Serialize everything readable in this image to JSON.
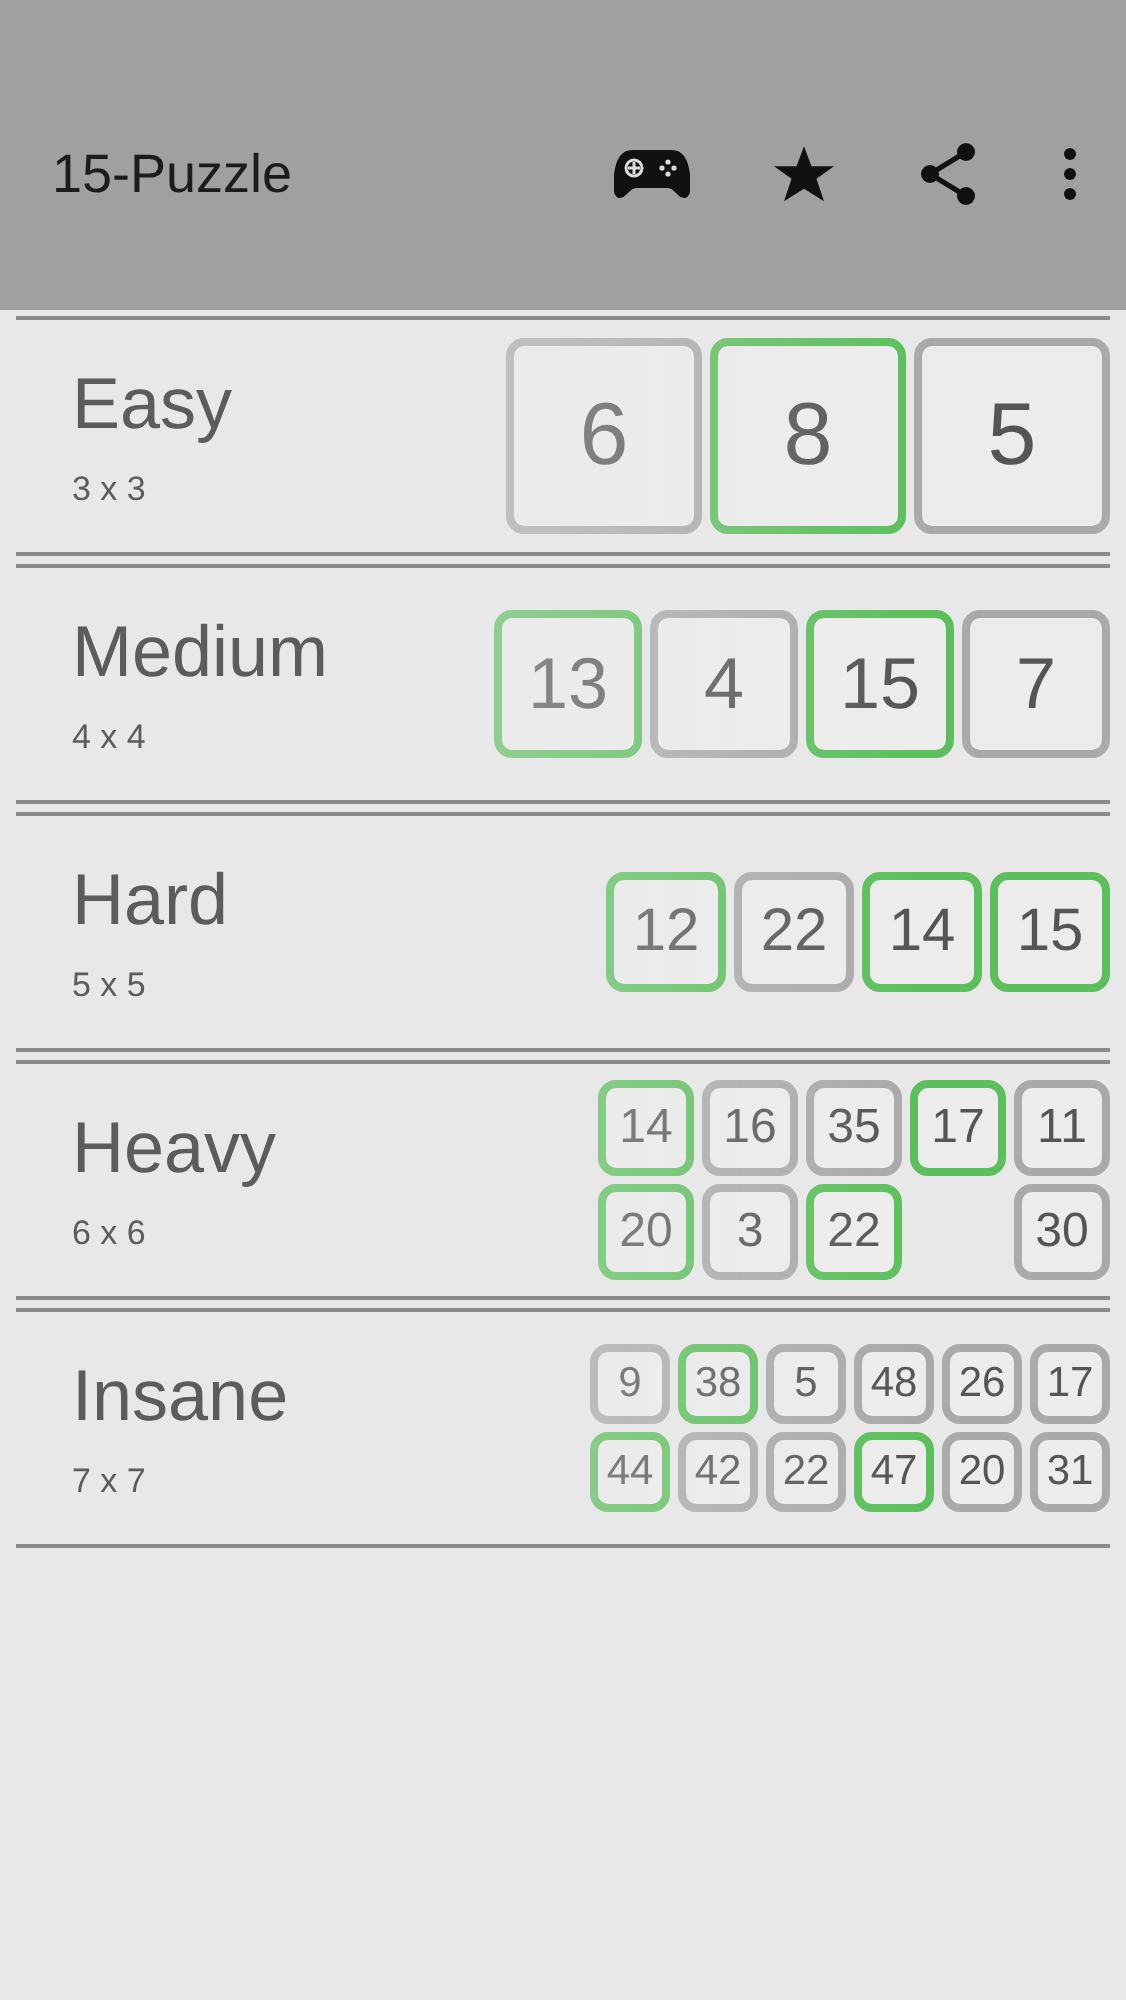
{
  "app_bar": {
    "title": "15-Puzzle"
  },
  "levels": [
    {
      "name": "Easy",
      "size": "3 x 3",
      "tile_rows": [
        [
          {
            "n": "6",
            "kind": "grey"
          },
          {
            "n": "8",
            "kind": "green"
          },
          {
            "n": "5",
            "kind": "grey"
          }
        ]
      ]
    },
    {
      "name": "Medium",
      "size": "4 x 4",
      "tile_rows": [
        [
          {
            "n": "13",
            "kind": "green"
          },
          {
            "n": "4",
            "kind": "grey"
          },
          {
            "n": "15",
            "kind": "green"
          },
          {
            "n": "7",
            "kind": "grey"
          }
        ]
      ]
    },
    {
      "name": "Hard",
      "size": "5 x 5",
      "tile_rows": [
        [
          {
            "n": "12",
            "kind": "green"
          },
          {
            "n": "22",
            "kind": "grey"
          },
          {
            "n": "14",
            "kind": "green"
          },
          {
            "n": "15",
            "kind": "green"
          }
        ]
      ]
    },
    {
      "name": "Heavy",
      "size": "6 x 6",
      "tile_rows": [
        [
          {
            "n": "14",
            "kind": "green"
          },
          {
            "n": "16",
            "kind": "grey"
          },
          {
            "n": "35",
            "kind": "grey"
          },
          {
            "n": "17",
            "kind": "green"
          },
          {
            "n": "11",
            "kind": "grey"
          }
        ],
        [
          {
            "n": "20",
            "kind": "green"
          },
          {
            "n": "3",
            "kind": "grey"
          },
          {
            "n": "22",
            "kind": "green"
          },
          {
            "kind": "empty"
          },
          {
            "n": "30",
            "kind": "grey"
          }
        ]
      ]
    },
    {
      "name": "Insane",
      "size": "7 x 7",
      "tile_rows": [
        [
          {
            "n": "9",
            "kind": "grey"
          },
          {
            "n": "38",
            "kind": "green"
          },
          {
            "n": "5",
            "kind": "grey"
          },
          {
            "n": "48",
            "kind": "grey"
          },
          {
            "n": "26",
            "kind": "grey"
          },
          {
            "n": "17",
            "kind": "grey"
          }
        ],
        [
          {
            "n": "44",
            "kind": "green"
          },
          {
            "n": "42",
            "kind": "grey"
          },
          {
            "n": "22",
            "kind": "grey"
          },
          {
            "n": "47",
            "kind": "green"
          },
          {
            "n": "20",
            "kind": "grey"
          },
          {
            "n": "31",
            "kind": "grey"
          }
        ]
      ]
    }
  ]
}
